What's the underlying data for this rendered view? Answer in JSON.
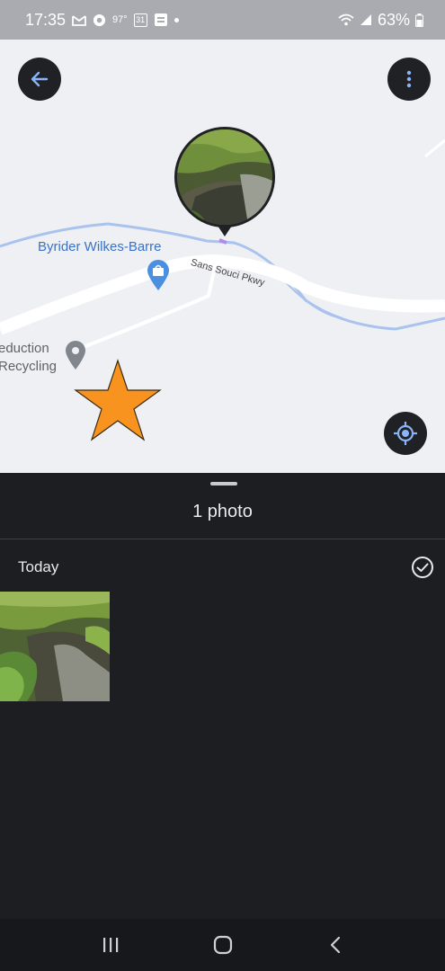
{
  "status_bar": {
    "time": "17:35",
    "temperature": "97°",
    "calendar_day": "31",
    "battery": "63%",
    "icons": [
      "gmail-icon",
      "chrome-icon",
      "calendar-icon",
      "news-icon",
      "wifi-icon",
      "signal-icon",
      "battery-icon"
    ]
  },
  "map": {
    "place_business": "Byrider Wilkes-Barre",
    "road_name": "Sans Souci Pkwy",
    "place_recycling_line1": "eduction",
    "place_recycling_line2": "Recycling",
    "water_color": "#a9c3ee",
    "road_color": "#ffffff",
    "accent_pin_color": "#4a8fe0",
    "star_color": "#f7931e"
  },
  "sheet": {
    "title": "1 photo",
    "section_label": "Today"
  },
  "nav_bar": {
    "buttons": [
      "recent-apps",
      "home",
      "back"
    ]
  }
}
